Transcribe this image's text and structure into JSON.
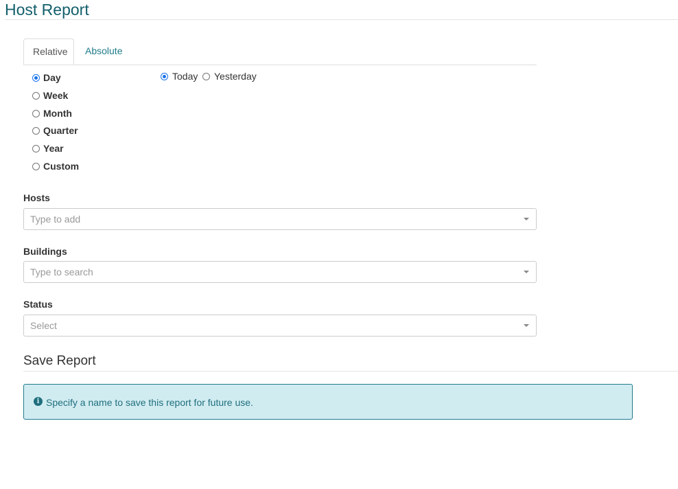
{
  "page": {
    "title": "Host Report"
  },
  "tabs": [
    {
      "label": "Relative",
      "active": true
    },
    {
      "label": "Absolute",
      "active": false
    }
  ],
  "period_options": [
    {
      "label": "Day",
      "checked": true
    },
    {
      "label": "Week",
      "checked": false
    },
    {
      "label": "Month",
      "checked": false
    },
    {
      "label": "Quarter",
      "checked": false
    },
    {
      "label": "Year",
      "checked": false
    },
    {
      "label": "Custom",
      "checked": false
    }
  ],
  "day_options": [
    {
      "label": "Today",
      "checked": true
    },
    {
      "label": "Yesterday",
      "checked": false
    }
  ],
  "hosts": {
    "label": "Hosts",
    "placeholder": "Type to add"
  },
  "buildings": {
    "label": "Buildings",
    "placeholder": "Type to search"
  },
  "status": {
    "label": "Status",
    "placeholder": "Select"
  },
  "save_report": {
    "title": "Save Report",
    "alert_text": "Specify a name to save this report for future use.",
    "alert_icon": "info-circle-icon"
  },
  "colors": {
    "title": "#135f6b",
    "link": "#1f7b8a",
    "alert_bg": "#d1ecf1",
    "alert_border": "#1f7b8a",
    "radio_checked": "#1a73e8"
  }
}
